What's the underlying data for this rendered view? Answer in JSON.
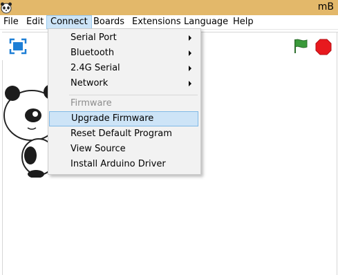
{
  "window": {
    "title": "mB"
  },
  "menubar": {
    "items": [
      {
        "label": "File"
      },
      {
        "label": "Edit"
      },
      {
        "label": "Connect"
      },
      {
        "label": "Boards"
      },
      {
        "label": "Extensions"
      },
      {
        "label": "Language"
      },
      {
        "label": "Help"
      }
    ],
    "active": "Connect"
  },
  "connect_menu": {
    "items": [
      {
        "label": "Serial Port",
        "submenu": true
      },
      {
        "label": "Bluetooth",
        "submenu": true
      },
      {
        "label": "2.4G Serial",
        "submenu": true
      },
      {
        "label": "Network",
        "submenu": true
      },
      {
        "label": "Firmware",
        "disabled": true
      },
      {
        "label": "Upgrade Firmware",
        "highlighted": true
      },
      {
        "label": "Reset Default Program"
      },
      {
        "label": "View Source"
      },
      {
        "label": "Install Arduino Driver"
      }
    ]
  },
  "icons": {
    "app": "panda-icon",
    "fullscreen": "fullscreen-icon",
    "green_flag": "green-flag-icon",
    "stop": "stop-sign-icon",
    "sprite": "panda-sprite"
  },
  "colors": {
    "titlebar": "#e3b86a",
    "menu_active_bg": "#cce4f7",
    "menu_hover_bg": "#cde4f7",
    "flag_green": "#3a9a3a",
    "stop_red": "#e8191e",
    "fullscreen_blue": "#1e7fd6"
  }
}
